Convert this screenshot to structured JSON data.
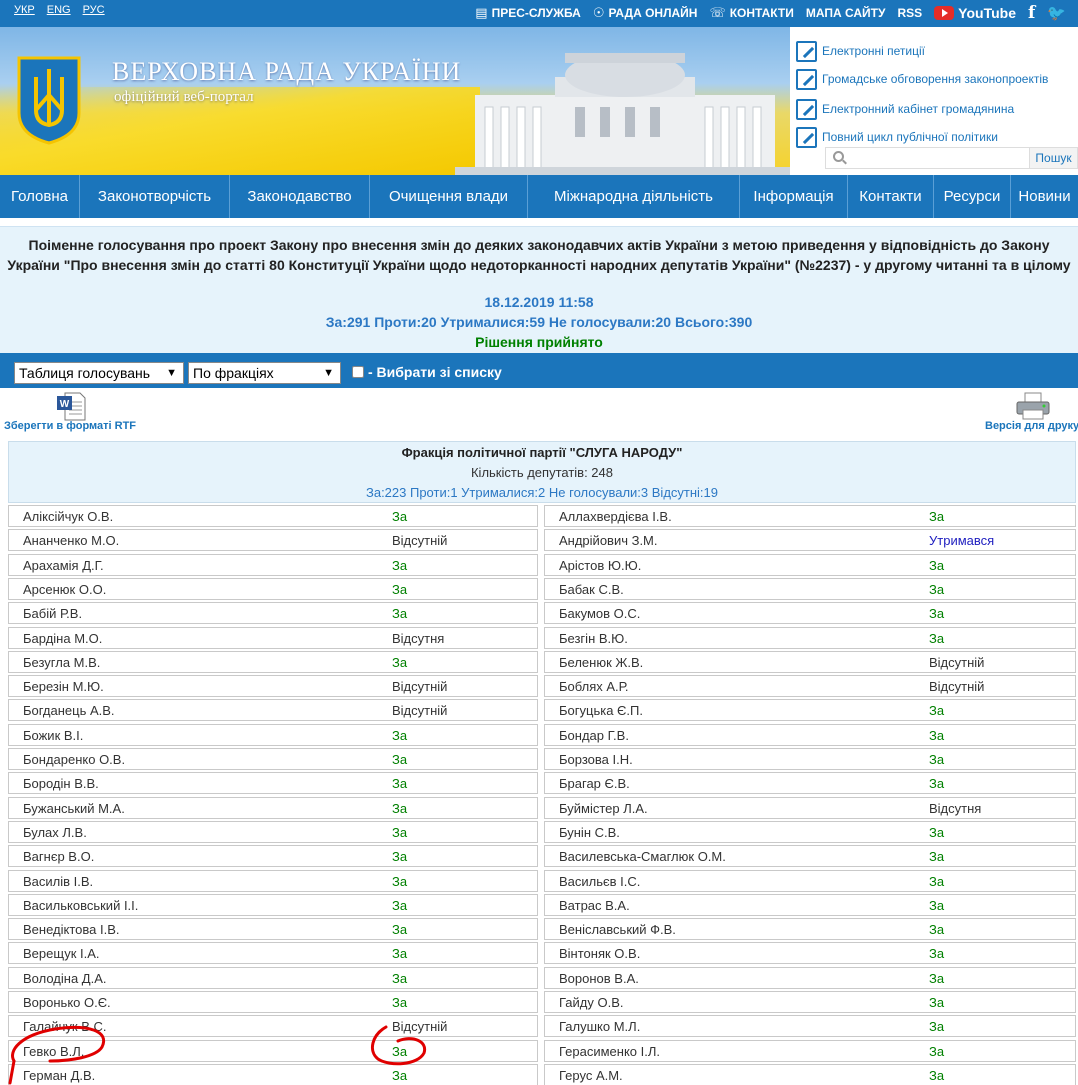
{
  "topbar": {
    "languages": [
      "УКР",
      "ENG",
      "РУС"
    ],
    "links": {
      "press": "ПРЕС-СЛУЖБА",
      "rada_online": "РАДА ОНЛАЙН",
      "contacts": "КОНТАКТИ",
      "sitemap": "МАПА САЙТУ",
      "rss": "RSS",
      "youtube": "YouTube"
    }
  },
  "header": {
    "title": "ВЕРХОВНА РАДА УКРАЇНИ",
    "subtitle": "офіційний веб-портал",
    "quick_links": [
      "Електронні петиції",
      "Громадське обговорення законопроектів",
      "Електронний кабінет громадянина",
      "Повний цикл публічної політики"
    ],
    "search_button": "Пошук",
    "search_value": ""
  },
  "nav": [
    {
      "label": "Головна"
    },
    {
      "label": "Законотворчість"
    },
    {
      "label": "Законодавство"
    },
    {
      "label": "Очищення влади"
    },
    {
      "label": "Міжнародна діяльність"
    },
    {
      "label": "Інформація"
    },
    {
      "label": "Контакти"
    },
    {
      "label": "Ресурси"
    },
    {
      "label": "Новини"
    }
  ],
  "vote": {
    "title": "Поіменне голосування про проект Закону про внесення змін до деяких законодавчих актів України з метою приведення у відповідність до Закону України \"Про внесення змін до статті 80 Конституції України щодо недоторканності народних депутатів України\" (№2237) - у другому читанні та в цілому",
    "datetime": "18.12.2019 11:58",
    "counts": "За:291 Проти:20 Утрималися:59 Не голосували:20 Всього:390",
    "decision": "Рішення прийнято"
  },
  "filters": {
    "view_select": "Таблиця голосувань",
    "group_select": "По фракціях",
    "choose_from_list": "- Вибрати зі списку"
  },
  "tools": {
    "save_rtf": "Зберегти в форматі RTF",
    "print_version": "Версія для друку"
  },
  "faction": {
    "name": "Фракція політичної партії \"СЛУГА НАРОДУ\"",
    "count": "Кількість депутатів: 248",
    "votes": "За:223 Проти:1 Утрималися:2 Не голосували:3 Відсутні:19"
  },
  "deputies": {
    "left": [
      {
        "name": "Аліксійчук О.В.",
        "vote": "За"
      },
      {
        "name": "Ананченко М.О.",
        "vote": "Відсутній"
      },
      {
        "name": "Арахамія Д.Г.",
        "vote": "За"
      },
      {
        "name": "Арсенюк О.О.",
        "vote": "За"
      },
      {
        "name": "Бабій Р.В.",
        "vote": "За"
      },
      {
        "name": "Бардіна М.О.",
        "vote": "Відсутня"
      },
      {
        "name": "Безугла М.В.",
        "vote": "За"
      },
      {
        "name": "Березін М.Ю.",
        "vote": "Відсутній"
      },
      {
        "name": "Богданець А.В.",
        "vote": "Відсутній"
      },
      {
        "name": "Божик В.І.",
        "vote": "За"
      },
      {
        "name": "Бондаренко О.В.",
        "vote": "За"
      },
      {
        "name": "Бородін В.В.",
        "vote": "За"
      },
      {
        "name": "Бужанський М.А.",
        "vote": "За"
      },
      {
        "name": "Булах Л.В.",
        "vote": "За"
      },
      {
        "name": "Вагнєр В.О.",
        "vote": "За"
      },
      {
        "name": "Василів І.В.",
        "vote": "За"
      },
      {
        "name": "Васильковський І.І.",
        "vote": "За"
      },
      {
        "name": "Венедіктова І.В.",
        "vote": "За"
      },
      {
        "name": "Верещук І.А.",
        "vote": "За"
      },
      {
        "name": "Володіна Д.А.",
        "vote": "За"
      },
      {
        "name": "Воронько О.Є.",
        "vote": "За"
      },
      {
        "name": "Галайчук В.С.",
        "vote": "Відсутній"
      },
      {
        "name": "Гевко В.Л.",
        "vote": "За"
      },
      {
        "name": "Герман Д.В.",
        "vote": "За"
      }
    ],
    "right": [
      {
        "name": "Аллахвердієва І.В.",
        "vote": "За"
      },
      {
        "name": "Андрійович З.М.",
        "vote": "Утримався"
      },
      {
        "name": "Арістов Ю.Ю.",
        "vote": "За"
      },
      {
        "name": "Бабак С.В.",
        "vote": "За"
      },
      {
        "name": "Бакумов О.С.",
        "vote": "За"
      },
      {
        "name": "Безгін В.Ю.",
        "vote": "За"
      },
      {
        "name": "Беленюк Ж.В.",
        "vote": "Відсутній"
      },
      {
        "name": "Боблях А.Р.",
        "vote": "Відсутній"
      },
      {
        "name": "Богуцька Є.П.",
        "vote": "За"
      },
      {
        "name": "Бондар Г.В.",
        "vote": "За"
      },
      {
        "name": "Борзова І.Н.",
        "vote": "За"
      },
      {
        "name": "Брагар Є.В.",
        "vote": "За"
      },
      {
        "name": "Буймістер Л.А.",
        "vote": "Відсутня"
      },
      {
        "name": "Бунін С.В.",
        "vote": "За"
      },
      {
        "name": "Василевська-Смаглюк О.М.",
        "vote": "За"
      },
      {
        "name": "Васильєв І.С.",
        "vote": "За"
      },
      {
        "name": "Ватрас В.А.",
        "vote": "За"
      },
      {
        "name": "Веніславський Ф.В.",
        "vote": "За"
      },
      {
        "name": "Вінтоняк О.В.",
        "vote": "За"
      },
      {
        "name": "Воронов В.А.",
        "vote": "За"
      },
      {
        "name": "Гайду О.В.",
        "vote": "За"
      },
      {
        "name": "Галушко М.Л.",
        "vote": "За"
      },
      {
        "name": "Герасименко І.Л.",
        "vote": "За"
      },
      {
        "name": "Герус А.М.",
        "vote": "За"
      }
    ]
  },
  "colors": {
    "brand_blue": "#1b75bb",
    "vote_for": "#008000",
    "vote_abstain": "#2020c0",
    "annotation_red": "#e00000"
  }
}
